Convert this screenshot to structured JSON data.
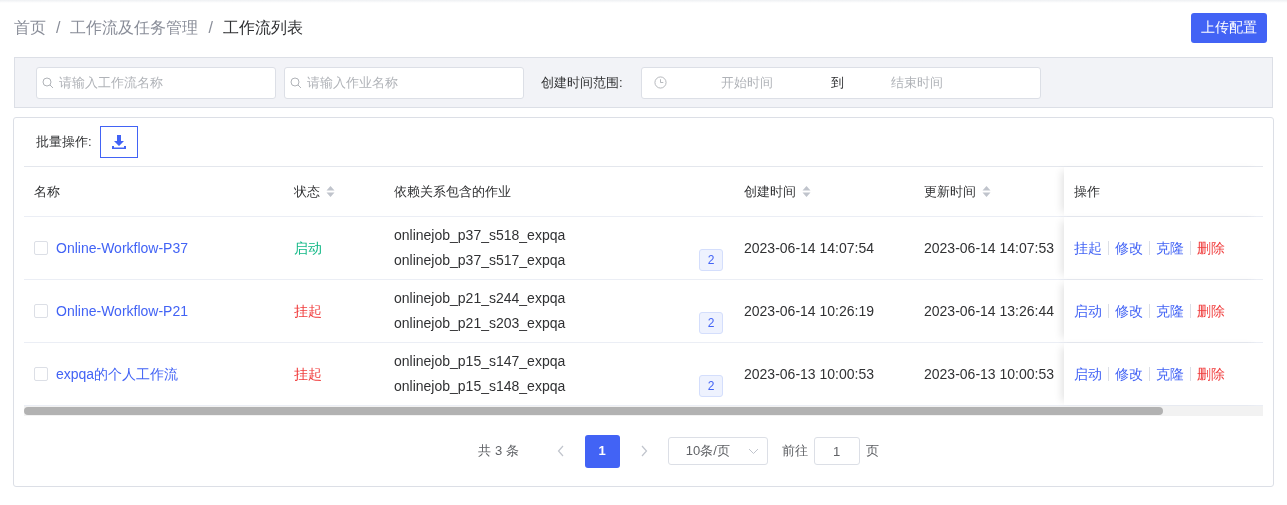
{
  "breadcrumb": [
    {
      "kind": "link",
      "label": "首页"
    },
    {
      "kind": "separator",
      "label": "/"
    },
    {
      "kind": "link",
      "label": "工作流及任务管理"
    },
    {
      "kind": "separator",
      "label": "/"
    },
    {
      "kind": "current",
      "label": "工作流列表"
    }
  ],
  "upload_button": "上传配置",
  "filters": {
    "workflow_search": {
      "placeholder": "请输入工作流名称"
    },
    "job_search": {
      "placeholder": "请输入作业名称"
    },
    "date_label": "创建时间范围:",
    "start_placeholder": "开始时间",
    "range_separator": "到",
    "end_placeholder": "结束时间"
  },
  "batch": {
    "label": "批量操作:"
  },
  "table": {
    "columns": [
      {
        "label": "名称"
      },
      {
        "label": "状态",
        "sortable": true
      },
      {
        "label": "依赖关系包含的作业"
      },
      {
        "label": "创建时间",
        "sortable": true
      },
      {
        "label": "更新时间",
        "sortable": true
      },
      {
        "label": "操作"
      }
    ],
    "rows": [
      {
        "checked": false,
        "name": "Online-Workflow-P37",
        "status": {
          "text": "启动",
          "kind": "running"
        },
        "jobs": [
          "onlinejob_p37_s518_expqa",
          "onlinejob_p37_s517_expqa"
        ],
        "job_count": "2",
        "created": "2023-06-14 14:07:54",
        "updated": "2023-06-14 14:07:53",
        "actions": [
          {
            "label": "挂起",
            "kind": "normal"
          },
          {
            "label": "修改",
            "kind": "normal"
          },
          {
            "label": "克隆",
            "kind": "normal"
          },
          {
            "label": "删除",
            "kind": "danger"
          }
        ]
      },
      {
        "checked": false,
        "name": "Online-Workflow-P21",
        "status": {
          "text": "挂起",
          "kind": "suspended"
        },
        "jobs": [
          "onlinejob_p21_s244_expqa",
          "onlinejob_p21_s203_expqa"
        ],
        "job_count": "2",
        "created": "2023-06-14 10:26:19",
        "updated": "2023-06-14 13:26:44",
        "actions": [
          {
            "label": "启动",
            "kind": "normal"
          },
          {
            "label": "修改",
            "kind": "normal"
          },
          {
            "label": "克隆",
            "kind": "normal"
          },
          {
            "label": "删除",
            "kind": "danger"
          }
        ]
      },
      {
        "checked": false,
        "name": "expqa的个人工作流",
        "status": {
          "text": "挂起",
          "kind": "suspended"
        },
        "jobs": [
          "onlinejob_p15_s147_expqa",
          "onlinejob_p15_s148_expqa"
        ],
        "job_count": "2",
        "created": "2023-06-13 10:00:53",
        "updated": "2023-06-13 10:00:53",
        "actions": [
          {
            "label": "启动",
            "kind": "normal"
          },
          {
            "label": "修改",
            "kind": "normal"
          },
          {
            "label": "克隆",
            "kind": "normal"
          },
          {
            "label": "删除",
            "kind": "danger"
          }
        ]
      }
    ]
  },
  "pagination": {
    "total": "共 3 条",
    "pages": [
      {
        "label": "1",
        "selected": true
      }
    ],
    "page_size": "10条/页",
    "goto_label": "前往",
    "goto_value": "1",
    "goto_suffix": "页"
  }
}
